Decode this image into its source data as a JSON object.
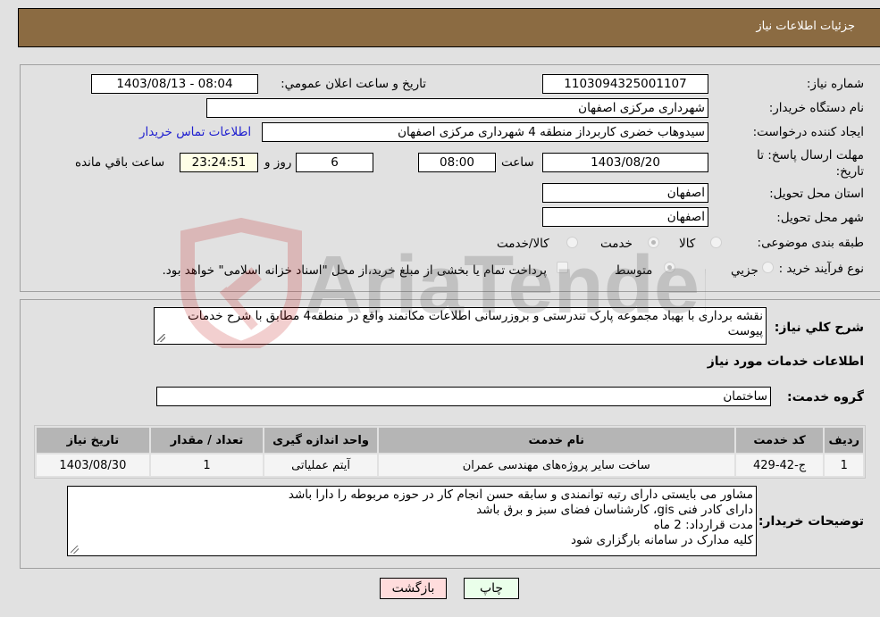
{
  "header": {
    "title": "جزئیات اطلاعات نیاز"
  },
  "fields": {
    "need_number": {
      "label": "شماره نیاز:",
      "value": "1103094325001107"
    },
    "announce_datetime": {
      "label": "تاریخ و ساعت اعلان عمومي:",
      "value": "1403/08/13 - 08:04"
    },
    "buyer_org": {
      "label": "نام دستگاه خریدار:",
      "value": "شهرداری مرکزی اصفهان"
    },
    "requester": {
      "label": "ایجاد کننده درخواست:",
      "value": "سیدوهاب خضری کاربرداز منطقه 4 شهرداری مرکزی اصفهان"
    },
    "buyer_contact_link": "اطلاعات تماس خریدار",
    "deadline": {
      "label": "مهلت ارسال پاسخ: تا تاریخ:",
      "date": "1403/08/20",
      "time_label": "ساعت",
      "time": "08:00",
      "days": "6",
      "days_label": "روز و",
      "remaining": "23:24:51",
      "remaining_label": "ساعت باقي مانده"
    },
    "province": {
      "label": "استان محل تحویل:",
      "value": "اصفهان"
    },
    "city": {
      "label": "شهر محل تحویل:",
      "value": "اصفهان"
    },
    "category": {
      "label": "طبقه بندی موضوعی:",
      "options": [
        "کالا",
        "خدمت",
        "کالا/خدمت"
      ],
      "selected": "خدمت"
    },
    "purchase_type": {
      "label": "نوع فرآیند خرید :",
      "options": [
        "جزيي",
        "متوسط"
      ],
      "selected": "متوسط",
      "treasury_checkbox_label": "پرداخت تمام یا بخشی از مبلغ خرید،از محل \"اسناد خزانه اسلامی\" خواهد بود.",
      "treasury_checked": false
    }
  },
  "details": {
    "general_desc_label": "شرح کلي نیاز:",
    "general_desc": "نقشه برداری با بهباد مجموعه پارک تندرستی و بروزرسانی اطلاعات مکانمند واقع در منطقه4 مطابق با شرح خدمات پیوست",
    "services_section_title": "اطلاعات خدمات مورد نیاز",
    "service_group_label": "گروه خدمت:",
    "service_group": "ساختمان",
    "table": {
      "headers": [
        "ردیف",
        "کد خدمت",
        "نام خدمت",
        "واحد اندازه گیری",
        "تعداد / مقدار",
        "تاریخ نیاز"
      ],
      "rows": [
        [
          "1",
          "ج-42-429",
          "ساخت سایر پروژه‌های مهندسی عمران",
          "آیتم عملیاتی",
          "1",
          "1403/08/30"
        ]
      ]
    },
    "buyer_notes_label": "توضیحات خریدار:",
    "buyer_notes": [
      "مشاور می بایستی دارای رتبه توانمندی و سابقه حسن انجام کار در حوزه مربوطه را دارا باشد",
      "دارای کادر فنی gis، کارشناسان فضای سبز و برق باشد",
      "مدت قرارداد: 2 ماه",
      "کلیه مدارک در سامانه بارگزاری شود"
    ]
  },
  "buttons": {
    "print": "چاپ",
    "back": "بازگشت"
  },
  "watermark": "AriaTender.neT",
  "colors": {
    "header_bg": "#8b6b42",
    "back_btn": "#ffdcdc",
    "print_btn": "#eaffea",
    "link": "#2020d0"
  }
}
